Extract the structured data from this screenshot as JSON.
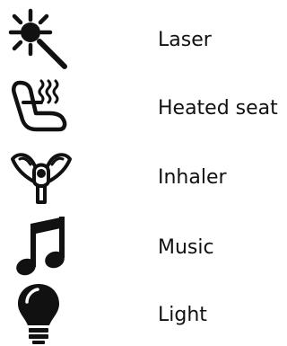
{
  "legend": {
    "items": [
      {
        "icon": "laser-icon",
        "label": "Laser"
      },
      {
        "icon": "heated-seat-icon",
        "label": "Heated seat"
      },
      {
        "icon": "inhaler-icon",
        "label": "Inhaler"
      },
      {
        "icon": "music-icon",
        "label": "Music"
      },
      {
        "icon": "light-icon",
        "label": "Light"
      }
    ]
  }
}
